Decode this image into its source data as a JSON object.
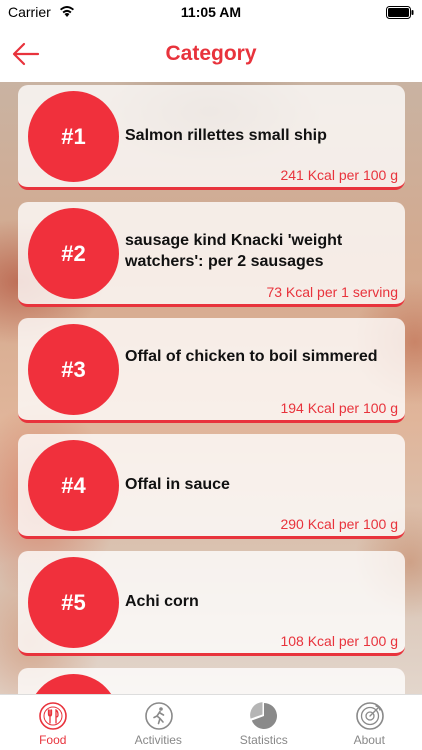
{
  "status_bar": {
    "carrier": "Carrier",
    "time": "11:05 AM"
  },
  "nav": {
    "title": "Category",
    "accent": "#e8333c"
  },
  "items": [
    {
      "rank": "#1",
      "name": "Salmon rillettes small ship",
      "kcal": "241 Kcal per 100 g"
    },
    {
      "rank": "#2",
      "name": "sausage kind Knacki 'weight watchers': per 2 sausages",
      "kcal": "73 Kcal per 1 serving"
    },
    {
      "rank": "#3",
      "name": "Offal of chicken to boil simmered",
      "kcal": "194 Kcal per 100 g"
    },
    {
      "rank": "#4",
      "name": "Offal in sauce",
      "kcal": "290 Kcal per 100 g"
    },
    {
      "rank": "#5",
      "name": "Achi corn",
      "kcal": "108 Kcal per 100 g"
    },
    {
      "rank": "",
      "name": "",
      "kcal": ""
    }
  ],
  "tabs": [
    {
      "label": "Food",
      "icon": "food-icon",
      "active": true
    },
    {
      "label": "Activities",
      "icon": "activities-icon",
      "active": false
    },
    {
      "label": "Statistics",
      "icon": "statistics-icon",
      "active": false
    },
    {
      "label": "About",
      "icon": "about-icon",
      "active": false
    }
  ]
}
